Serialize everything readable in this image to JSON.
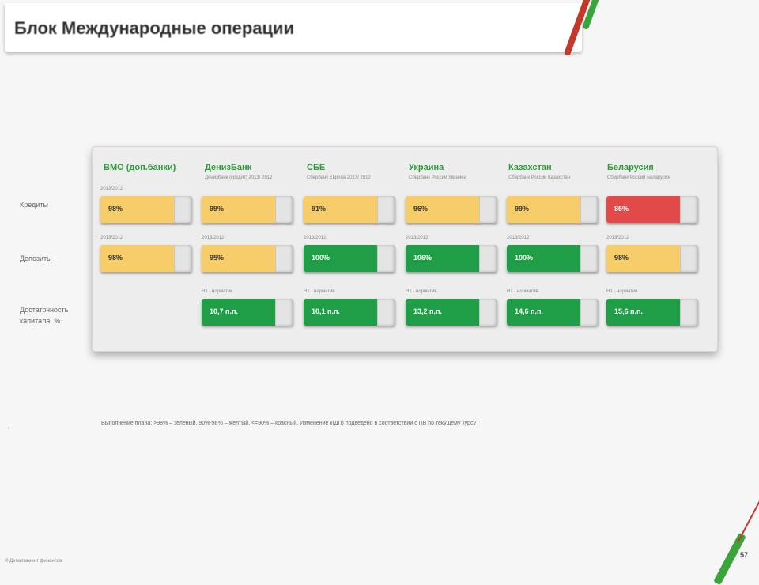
{
  "title": "Блок Международные операции",
  "row_labels": [
    "Кредиты",
    "Депозиты",
    "Достаточность капитала, %"
  ],
  "columns": [
    {
      "name": "ВМО (доп.банки)",
      "subtitle": ""
    },
    {
      "name": "ДенизБанк",
      "subtitle": "Денизбанк (кредит) 2013/ 2012"
    },
    {
      "name": "СБЕ",
      "subtitle": "Сбербанк Европа 2013/ 2012"
    },
    {
      "name": "Украина",
      "subtitle": "Сбербанк России Украина"
    },
    {
      "name": "Казахстан",
      "subtitle": "Сбербанк России Казахстан"
    },
    {
      "name": "Беларусия",
      "subtitle": "Сбербанк России Беларусия"
    }
  ],
  "cells": {
    "credits": [
      {
        "note": "2013/2012",
        "value": "98%",
        "color": "yellow"
      },
      {
        "note": "",
        "value": "99%",
        "color": "yellow"
      },
      {
        "note": "",
        "value": "91%",
        "color": "yellow"
      },
      {
        "note": "",
        "value": "96%",
        "color": "yellow"
      },
      {
        "note": "",
        "value": "99%",
        "color": "yellow"
      },
      {
        "note": "",
        "value": "85%",
        "color": "red"
      }
    ],
    "deposits": [
      {
        "note": "2013/2012",
        "value": "98%",
        "color": "yellow"
      },
      {
        "note": "2013/2012",
        "value": "95%",
        "color": "yellow"
      },
      {
        "note": "2013/2012",
        "value": "100%",
        "color": "green"
      },
      {
        "note": "2013/2012",
        "value": "106%",
        "color": "green"
      },
      {
        "note": "2013/2012",
        "value": "100%",
        "color": "green"
      },
      {
        "note": "2013/2012",
        "value": "98%",
        "color": "yellow"
      }
    ],
    "capital": [
      {
        "note": "",
        "value": "",
        "color": ""
      },
      {
        "note": "Н1 - норматив",
        "value": "10,7 п.п.",
        "color": "green"
      },
      {
        "note": "Н1 - норматив",
        "value": "10,1 п.п.",
        "color": "green"
      },
      {
        "note": "Н1 - норматив",
        "value": "13,2 п.п.",
        "color": "green"
      },
      {
        "note": "Н1 - норматив",
        "value": "14,6 п.п.",
        "color": "green"
      },
      {
        "note": "Н1 - норматив",
        "value": "15,6 п.п.",
        "color": "green"
      }
    ]
  },
  "footnote": "Выполнение плана: >98% – зеленый, 90%-98% – желтый, <=90% – красный. Изменение к(ДП) подведено в соответствии с ПВ по текущему курсу",
  "footnote_marker": "¹",
  "copyright": "© Департамент финансов",
  "page_number": "57",
  "colors": {
    "yellow": "#f6cd68",
    "green": "#1f9e47",
    "red": "#e24a4a",
    "title_green": "#2e9b3a"
  }
}
